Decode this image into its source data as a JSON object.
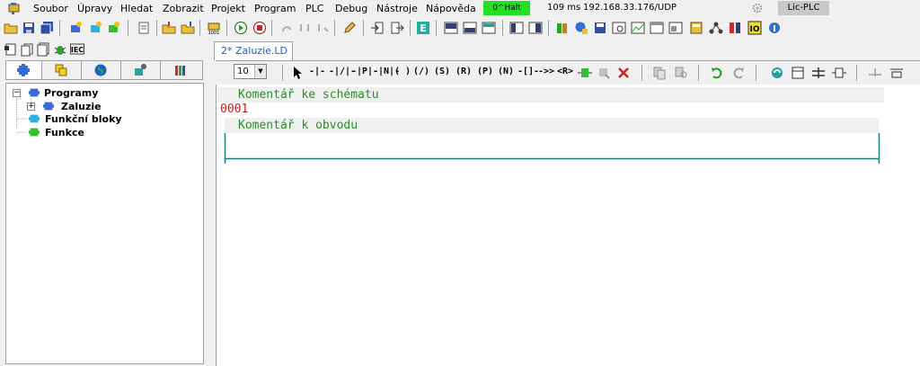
{
  "menubar": {
    "items": [
      "Soubor",
      "Úpravy",
      "Hledat",
      "Zobrazit",
      "Projekt",
      "Program",
      "PLC",
      "Debug",
      "Nástroje",
      "Nápověda"
    ],
    "status_halt": "0^Halt",
    "status_time": "109 ms",
    "status_connection": "192.168.33.176/UDP",
    "license": "Lic-PLC"
  },
  "document_tab": {
    "label": "2* Zaluzie.LD"
  },
  "editor_toolbar": {
    "zoom_value": "10",
    "ld_symbols": [
      "-|-",
      "-|/|-",
      "-|P|-",
      "-|N|-",
      "( )",
      "(/)",
      "(S)",
      "(R)",
      "(P)",
      "(N)",
      "-[]-",
      "->>",
      "<R>"
    ]
  },
  "tree": {
    "items": [
      {
        "label": "Programy",
        "expanded": true
      },
      {
        "label": "Zaluzie",
        "expandable": true
      },
      {
        "label": "Funkční bloky"
      },
      {
        "label": "Funkce"
      }
    ]
  },
  "editor": {
    "schema_comment": "Komentář ke schématu",
    "rung_number": "0001",
    "rung_comment": "Komentář k obvodu"
  },
  "colors": {
    "accent_green": "#22e022",
    "comment_green": "#2e8b2e",
    "rung_red": "#c02020",
    "rung_line": "#1a7f7f",
    "tab_blue": "#2060c0"
  }
}
